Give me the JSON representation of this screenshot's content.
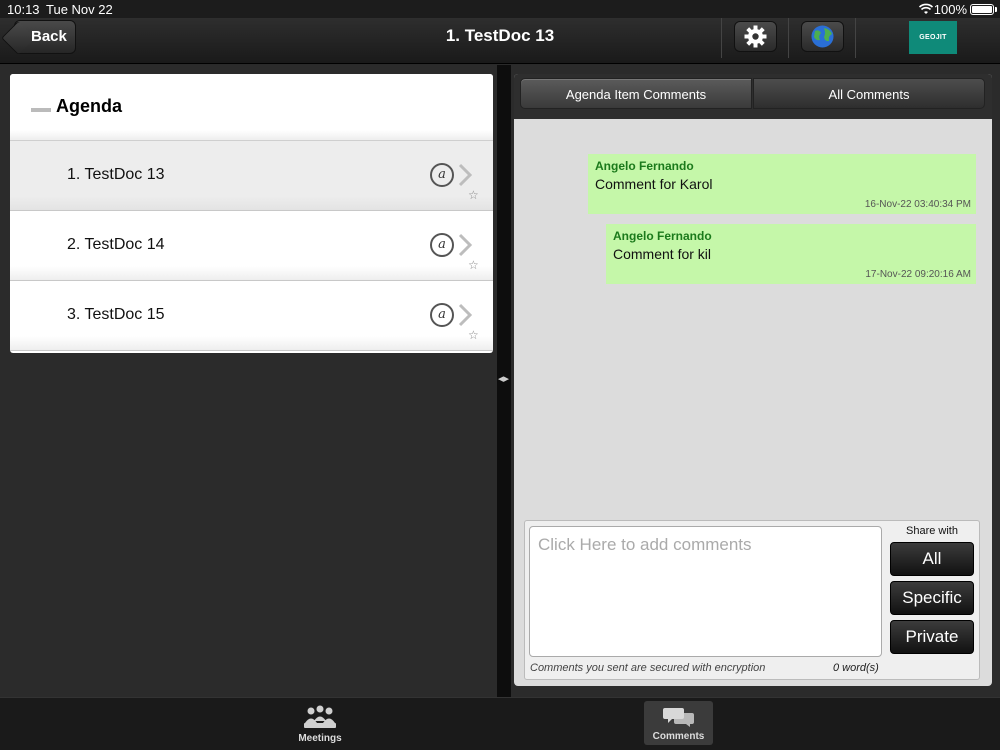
{
  "status_bar": {
    "time": "10:13",
    "date": "Tue Nov 22",
    "battery": "100%"
  },
  "nav": {
    "back_label": "Back",
    "title": "1. TestDoc 13",
    "logo_text": "GEOJIT",
    "icons": [
      "gear-icon",
      "globe-icon"
    ]
  },
  "agenda": {
    "title": "Agenda",
    "items": [
      {
        "label": "1. TestDoc 13",
        "selected": true
      },
      {
        "label": "2. TestDoc 14",
        "selected": false
      },
      {
        "label": "3. TestDoc 15",
        "selected": false
      }
    ]
  },
  "comments_panel": {
    "tabs": [
      "Agenda Item Comments",
      "All Comments"
    ],
    "active_tab": "Agenda Item Comments",
    "comments": [
      {
        "author": "Angelo Fernando",
        "text": "Comment for Karol",
        "timestamp": "16-Nov-22 03:40:34 PM"
      },
      {
        "author": "Angelo Fernando",
        "text": "Comment for kil",
        "timestamp": "17-Nov-22 09:20:16 AM"
      }
    ],
    "compose": {
      "placeholder": "Click Here to add comments",
      "share_label": "Share with",
      "share_options": [
        "All",
        "Specific",
        "Private"
      ],
      "encryption_note": "Comments you sent are secured with encryption",
      "word_count": "0 word(s)"
    }
  },
  "tabbar": {
    "items": [
      "Meetings",
      "Comments"
    ],
    "active": "Comments"
  },
  "colors": {
    "comment_bubble": "#c5f7a9",
    "author_text": "#1b7a1b",
    "logo_bg": "#0f8a79"
  }
}
